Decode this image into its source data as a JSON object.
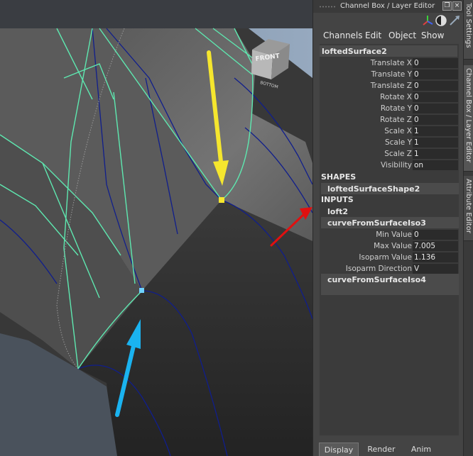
{
  "viewport": {
    "view_cube": {
      "front_label": "FRONT",
      "side_label": "BOTTOM"
    }
  },
  "panel": {
    "title": "Channel Box / Layer Editor",
    "menu": [
      "Channels",
      "Edit",
      "Object",
      "Show"
    ],
    "node_name": "loftedSurface2",
    "attributes": [
      {
        "label": "Translate X",
        "value": "0"
      },
      {
        "label": "Translate Y",
        "value": "0"
      },
      {
        "label": "Translate Z",
        "value": "0"
      },
      {
        "label": "Rotate X",
        "value": "0"
      },
      {
        "label": "Rotate Y",
        "value": "0"
      },
      {
        "label": "Rotate Z",
        "value": "0"
      },
      {
        "label": "Scale X",
        "value": "1"
      },
      {
        "label": "Scale Y",
        "value": "1"
      },
      {
        "label": "Scale Z",
        "value": "1"
      },
      {
        "label": "Visibility",
        "value": "on"
      }
    ],
    "shapes_header": "SHAPES",
    "shape_node": "loftedSurfaceShape2",
    "inputs_header": "INPUTS",
    "input_nodes": [
      "loft2",
      "curveFromSurfaceIso3"
    ],
    "iso_attributes": [
      {
        "label": "Min Value",
        "value": "0"
      },
      {
        "label": "Max Value",
        "value": "7.005"
      },
      {
        "label": "Isoparm Value",
        "value": "1.136"
      },
      {
        "label": "Isoparm Direction",
        "value": "V"
      }
    ],
    "last_input_node": "curveFromSurfaceIso4",
    "bottom_tabs": [
      "Display",
      "Render",
      "Anim"
    ],
    "active_tab": "Display"
  },
  "side_tabs": [
    "Tool Settings",
    "Channel Box / Layer Editor",
    "Attribute Editor"
  ],
  "colors": {
    "arrow_yellow": "#f5e62e",
    "arrow_blue": "#1ab3f0",
    "arrow_red": "#e01010",
    "selection_green": "#5ee8b0",
    "isoparm_blue": "#101e8c"
  }
}
